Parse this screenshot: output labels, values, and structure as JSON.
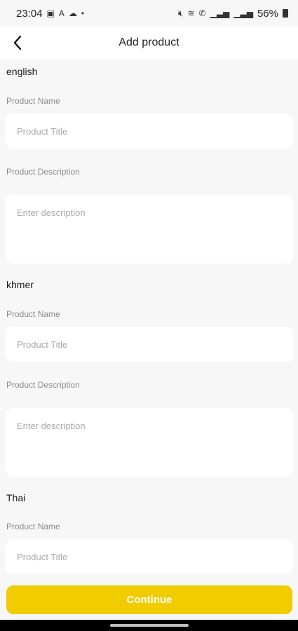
{
  "status_bar": {
    "time": "23:04",
    "battery_text": "56%",
    "left_icons": [
      "image-icon",
      "a-icon",
      "cloud-icon",
      "dot-icon"
    ],
    "right_icons": [
      "mute-icon",
      "wifi-icon",
      "call-icon",
      "signal-icon",
      "signal-icon",
      "battery-icon"
    ]
  },
  "header": {
    "title": "Add product",
    "back_icon": "chevron-left-icon"
  },
  "sections": [
    {
      "language": "english",
      "name_label": "Product Name",
      "name_placeholder": "Product Title",
      "description_label": "Product Description",
      "description_placeholder": "Enter description"
    },
    {
      "language": "khmer",
      "name_label": "Product Name",
      "name_placeholder": "Product Title",
      "description_label": "Product Description",
      "description_placeholder": "Enter description"
    },
    {
      "language": "Thai",
      "name_label": "Product Name",
      "name_placeholder": "Product Title"
    }
  ],
  "footer": {
    "continue_label": "Continue"
  },
  "colors": {
    "accent": "#f0cc00",
    "background": "#f7f7f7",
    "card": "#ffffff",
    "label": "#8a8a8a",
    "placeholder": "#a8a8a8"
  }
}
